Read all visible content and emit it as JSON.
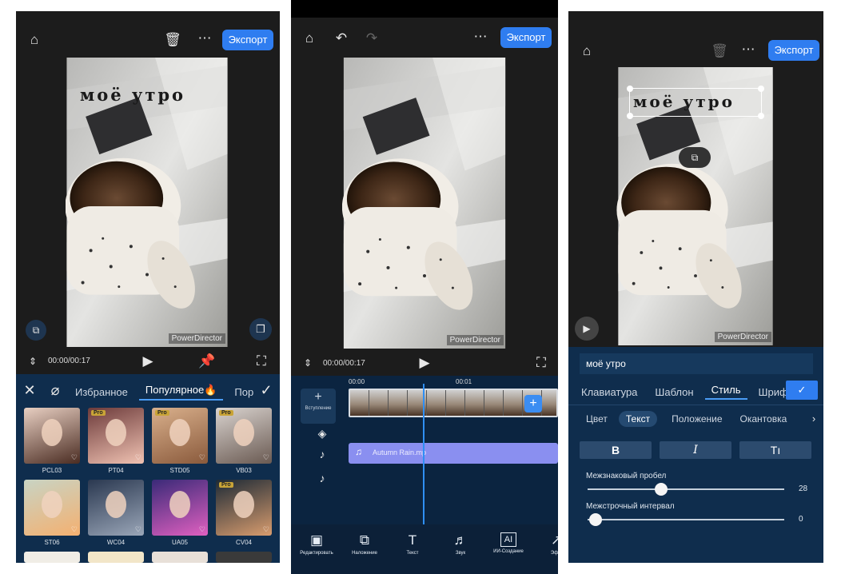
{
  "panel1": {
    "top_icons": [
      "home-icon",
      "trash-icon",
      "more-icon"
    ],
    "export_label": "Экспорт",
    "overlay_text": "моё утро",
    "watermark": "PowerDirector",
    "timecode": "00:00/00:17",
    "filter_tabs": [
      "Избранное",
      "Популярное🔥",
      "Пор"
    ],
    "filters": [
      {
        "name": "PCL03",
        "pro": false
      },
      {
        "name": "PT04",
        "pro": true
      },
      {
        "name": "STD05",
        "pro": true
      },
      {
        "name": "VB03",
        "pro": true
      },
      {
        "name": "ST06",
        "pro": false
      },
      {
        "name": "WC04",
        "pro": false
      },
      {
        "name": "UA05",
        "pro": false
      },
      {
        "name": "CV04",
        "pro": true
      }
    ],
    "pro_badge": "Pro"
  },
  "panel2": {
    "export_label": "Экспорт",
    "timecode": "00:00/00:17",
    "watermark": "PowerDirector",
    "ruler": [
      "00:00",
      "00:01"
    ],
    "intro_label": "Вступление",
    "audio_clip": "Autumn Rain.mp",
    "tools": [
      {
        "label": "Редактировать",
        "icon": "edit-icon"
      },
      {
        "label": "Наложение",
        "icon": "overlay-icon"
      },
      {
        "label": "Текст",
        "icon": "text-icon"
      },
      {
        "label": "Звук",
        "icon": "sound-icon"
      },
      {
        "label": "ИИ-Создание",
        "icon": "ai-icon"
      },
      {
        "label": "Эфф",
        "icon": "effect-icon"
      }
    ]
  },
  "panel3": {
    "export_label": "Экспорт",
    "overlay_text": "моё утро",
    "watermark": "PowerDirector",
    "text_field": "моё утро",
    "tabs": [
      "Клавиатура",
      "Шаблон",
      "Стиль",
      "Шрифт"
    ],
    "active_tab": "Стиль",
    "subtabs": [
      "Цвет",
      "Текст",
      "Положение",
      "Окантовка"
    ],
    "active_subtab": "Текст",
    "format_buttons": [
      "B",
      "I",
      "Tı"
    ],
    "letter_spacing_label": "Межзнаковый пробел",
    "letter_spacing_value": "28",
    "letter_spacing_level": 0.34,
    "line_spacing_label": "Межстрочный интервал",
    "line_spacing_value": "0",
    "line_spacing_level": 0.0
  },
  "colors": {
    "accent": "#2f7df0",
    "panel_blue": "#0f2d4d",
    "audio_track": "#8a8ff0"
  }
}
